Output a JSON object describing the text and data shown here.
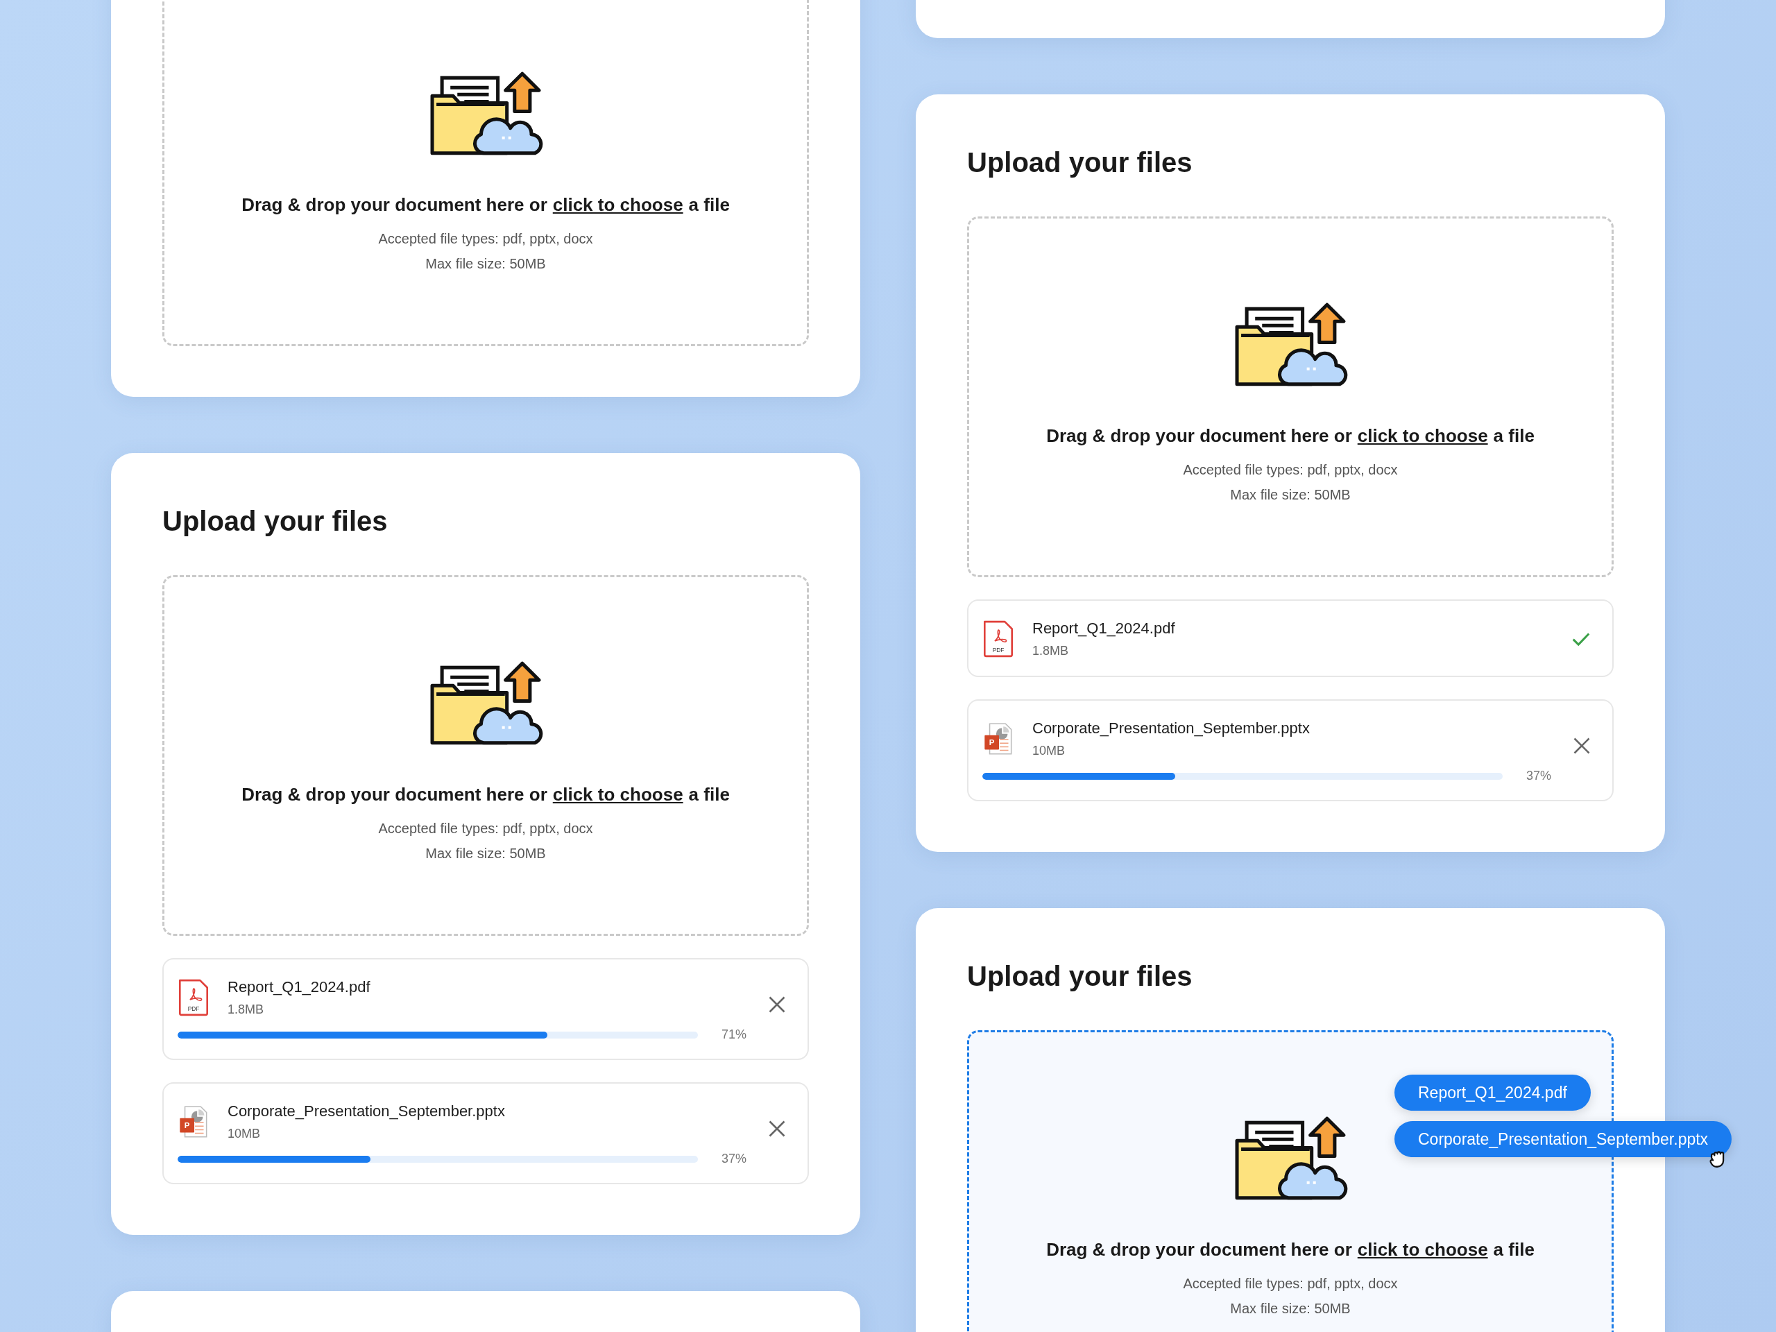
{
  "left_column": [
    {
      "dropzone": {
        "drag_over": false,
        "prompt_before": "Drag & drop your document here or",
        "link": "click to choose",
        "prompt_after": "a file",
        "accepted": "Accepted file types: pdf, pptx, docx",
        "max_size": "Max file size: 50MB"
      }
    },
    {
      "title": "Upload your files",
      "dropzone": {
        "drag_over": false,
        "prompt_before": "Drag & drop your document here or",
        "link": "click to choose",
        "prompt_after": "a file",
        "accepted": "Accepted file types: pdf, pptx, docx",
        "max_size": "Max file size: 50MB"
      },
      "files": [
        {
          "name": "Report_Q1_2024.pdf",
          "size": "1.8MB",
          "kind": "pdf",
          "icon_label": "PDF",
          "completed": false,
          "level": 0.71,
          "percent": "71%"
        },
        {
          "name": "Corporate_Presentation_September.pptx",
          "size": "10MB",
          "kind": "pptx",
          "icon_label": "P",
          "completed": false,
          "level": 0.37,
          "percent": "37%"
        }
      ]
    }
  ],
  "right_column": [
    {
      "title": "Upload your files",
      "dropzone": {
        "drag_over": false,
        "prompt_before": "Drag & drop your document here or",
        "link": "click to choose",
        "prompt_after": "a file",
        "accepted": "Accepted file types: pdf, pptx, docx",
        "max_size": "Max file size: 50MB"
      },
      "files": [
        {
          "name": "Report_Q1_2024.pdf",
          "size": "1.8MB",
          "kind": "pdf",
          "icon_label": "PDF",
          "completed": true
        },
        {
          "name": "Corporate_Presentation_September.pptx",
          "size": "10MB",
          "kind": "pptx",
          "icon_label": "P",
          "completed": false,
          "level": 0.37,
          "percent": "37%"
        }
      ]
    },
    {
      "title": "Upload your files",
      "dropzone": {
        "drag_over": true,
        "prompt_before": "Drag & drop your document here or",
        "link": "click to choose",
        "prompt_after": "a file",
        "accepted": "Accepted file types: pdf, pptx, docx",
        "max_size": "Max file size: 50MB"
      },
      "dragged_files": [
        {
          "name": "Report_Q1_2024.pdf",
          "pointer": false
        },
        {
          "name": "Corporate_Presentation_September.pptx",
          "pointer": true
        }
      ]
    }
  ]
}
